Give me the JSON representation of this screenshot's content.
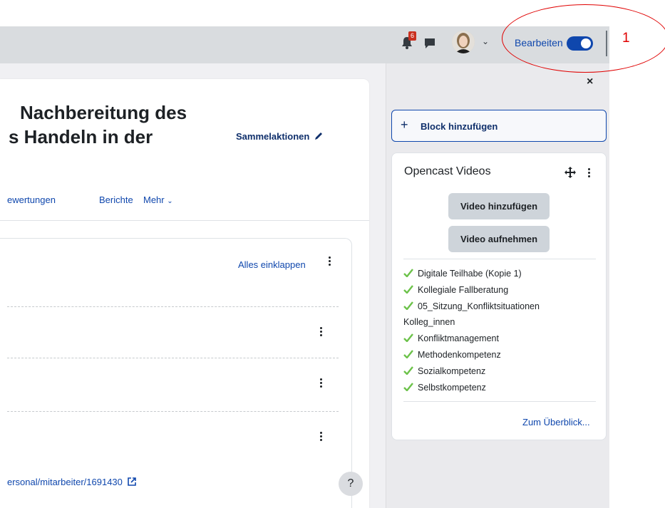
{
  "header": {
    "notification_count": "6",
    "edit_mode_label": "Bearbeiten",
    "annotation_number": "1"
  },
  "course": {
    "title_line1": "Nachbereitung des",
    "title_line2": "s Handeln in der",
    "bulk_actions_label": "Sammelaktionen",
    "nav": [
      "ewertungen",
      "Berichte",
      "Mehr"
    ],
    "collapse_all_label": "Alles einklappen",
    "link_text": "ersonal/mitarbeiter/1691430"
  },
  "help": {
    "label": "?"
  },
  "drawer": {
    "close_label": "×",
    "add_block_label": "Block hinzufügen",
    "add_block_icon": "+",
    "opencast": {
      "title": "Opencast Videos",
      "add_video_label": "Video hinzufügen",
      "record_video_label": "Video aufnehmen",
      "videos": [
        "Digitale Teilhabe (Kopie 1)",
        "Kollegiale Fallberatung",
        "05_Sitzung_Konfliktsituationen",
        "Kolleg_innen",
        "Konfliktmanagement",
        "Methodenkompetenz",
        "Sozialkompetenz",
        "Selbstkompetenz"
      ],
      "overview_label": "Zum Überblick..."
    }
  },
  "colors": {
    "accent": "#0f47ad",
    "annotation": "#e00000",
    "check": "#6cc24a",
    "badge": "#ca3120"
  }
}
